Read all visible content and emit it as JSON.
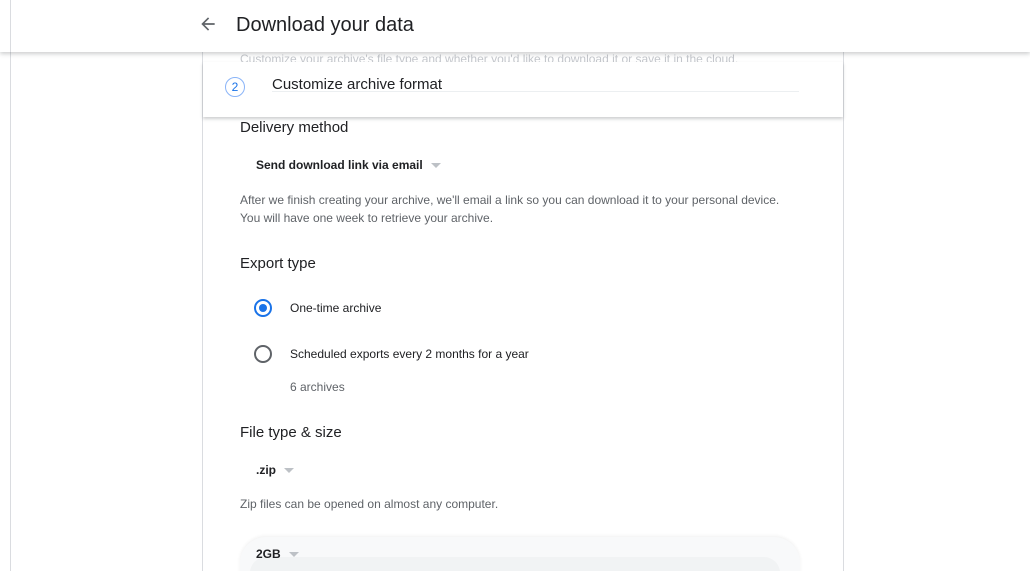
{
  "header": {
    "title": "Download your data",
    "back_icon": "arrow-back-icon"
  },
  "step": {
    "number": "2",
    "label": "Customize archive format",
    "faded_text": "Customize your archive's file type and whether you'd like to download it or save it in the cloud."
  },
  "delivery": {
    "title": "Delivery method",
    "selected": "Send download link via email",
    "description": "After we finish creating your archive, we'll email a link so you can download it to your personal device. You will have one week to retrieve your archive."
  },
  "export": {
    "title": "Export type",
    "options": [
      {
        "label": "One-time archive",
        "checked": true
      },
      {
        "label": "Scheduled exports every 2 months for a year",
        "checked": false,
        "note": "6 archives"
      }
    ]
  },
  "file": {
    "title": "File type & size",
    "type_selected": ".zip",
    "type_description": "Zip files can be opened on almost any computer.",
    "size_selected": "2GB"
  },
  "colors": {
    "accent": "#1a73e8",
    "text": "#202124",
    "secondary_text": "#5f6368",
    "divider": "#dadce0"
  }
}
